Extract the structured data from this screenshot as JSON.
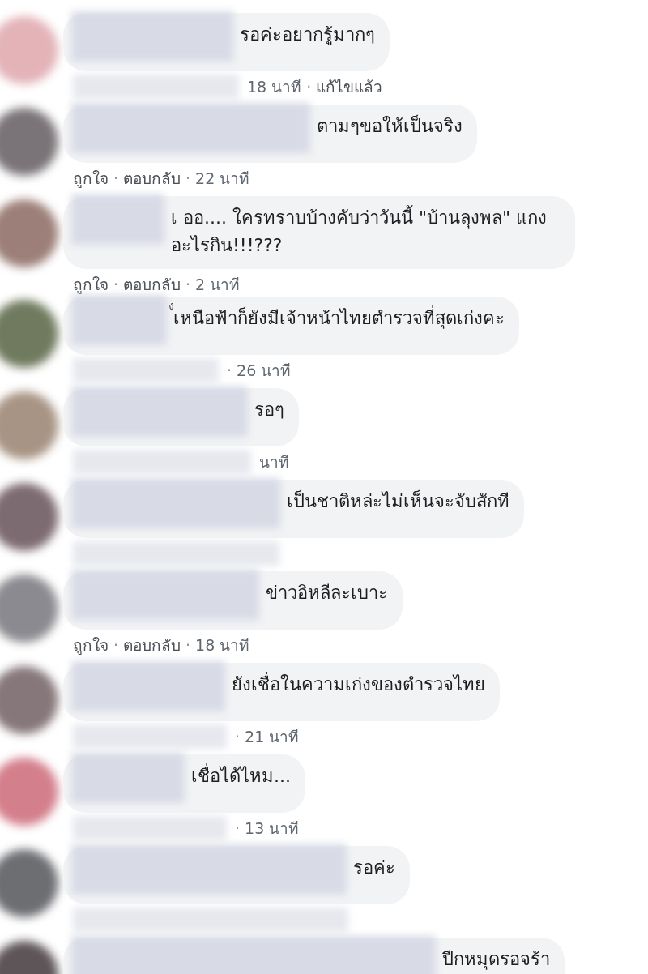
{
  "comments": [
    {
      "text": "รอค่ะอยากรู้มากๆ",
      "meta": [
        {
          "kind": "time",
          "text": "18 นาที"
        },
        {
          "kind": "sep",
          "text": "·"
        },
        {
          "kind": "status",
          "text": "แก้ไขแล้ว"
        }
      ]
    },
    {
      "text": "ตามๆขอให้เป็นจริง",
      "meta": [
        {
          "kind": "link",
          "text": "ถูกใจ"
        },
        {
          "kind": "sep",
          "text": "·"
        },
        {
          "kind": "link",
          "text": "ตอบกลับ"
        },
        {
          "kind": "sep",
          "text": "·"
        },
        {
          "kind": "time",
          "text": "22 นาที"
        }
      ]
    },
    {
      "text": "เ ออ.... ใครทราบบ้างคับว่าวันนี้ \"บ้านลุงพล\" แกง อะไรกิน!!!???",
      "meta": [
        {
          "kind": "link",
          "text": "ถูกใจ"
        },
        {
          "kind": "sep",
          "text": "·"
        },
        {
          "kind": "link",
          "text": "ตอบกลับ"
        },
        {
          "kind": "sep",
          "text": "·"
        },
        {
          "kind": "time",
          "text": "2 นาที"
        }
      ]
    },
    {
      "name_fragment": "ง",
      "text": "เหนือฟ้าก็ยังมีเจ้าหน้าไทยตำรวจที่สุดเก่งคะ",
      "meta": [
        {
          "kind": "sep",
          "text": "·"
        },
        {
          "kind": "time",
          "text": "26 นาที"
        }
      ]
    },
    {
      "text": "รอๆ",
      "meta": [
        {
          "kind": "time",
          "text": "นาที"
        }
      ]
    },
    {
      "text": "เป็นชาติหล่ะไม่เห็นจะจับสักที"
    },
    {
      "text": "ข่าวอิหลีละเบาะ",
      "meta": [
        {
          "kind": "link",
          "text": "ถูกใจ"
        },
        {
          "kind": "sep",
          "text": "·"
        },
        {
          "kind": "link",
          "text": "ตอบกลับ"
        },
        {
          "kind": "sep",
          "text": "·"
        },
        {
          "kind": "time",
          "text": "18 นาที"
        }
      ]
    },
    {
      "text": "ยังเชื่อในความเก่งของตำรวจไทย",
      "meta": [
        {
          "kind": "sep",
          "text": "·"
        },
        {
          "kind": "time",
          "text": "21 นาที"
        }
      ]
    },
    {
      "text": "เชื่อได้ไหม...",
      "meta": [
        {
          "kind": "sep",
          "text": "·"
        },
        {
          "kind": "time",
          "text": "13 นาที"
        }
      ]
    },
    {
      "text": "รอค่ะ"
    },
    {
      "text": "ปีกหมุดรอจร้า"
    }
  ]
}
